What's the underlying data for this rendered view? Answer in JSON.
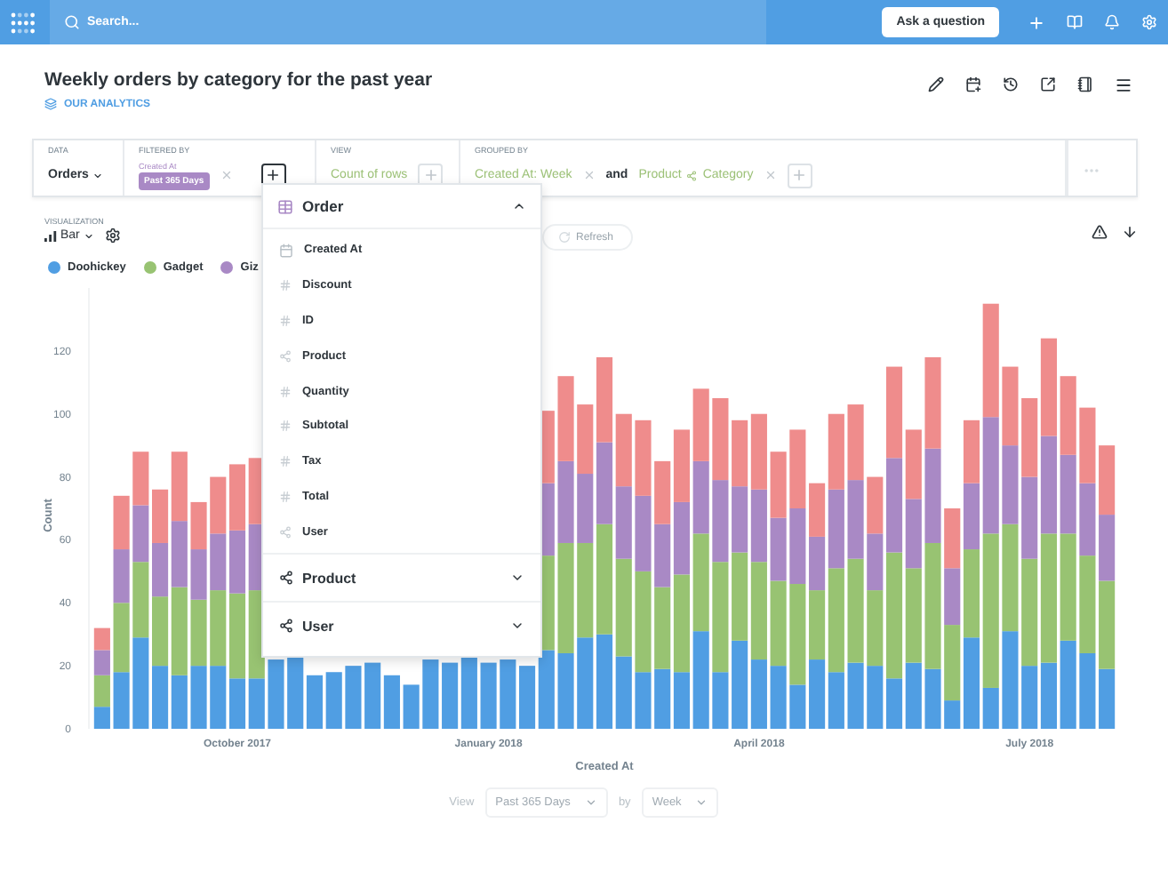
{
  "nav": {
    "search": {
      "placeholder": "Search..."
    },
    "ask_button": "Ask a question"
  },
  "question": {
    "title": "Weekly orders by category for the past year",
    "collection": "OUR ANALYTICS"
  },
  "builder": {
    "data": {
      "label": "DATA",
      "value": "Orders"
    },
    "filter": {
      "label": "FILTERED BY",
      "field": "Created At",
      "value": "Past 365 Days",
      "add_open": true
    },
    "view": {
      "label": "VIEW",
      "metric": "Count of rows"
    },
    "group": {
      "label": "GROUPED BY",
      "connector": "and",
      "items": [
        {
          "field": "Created At: Week"
        },
        {
          "table": "Product",
          "field": "Category"
        }
      ]
    }
  },
  "popover": {
    "table": "Order",
    "expanded": true,
    "fields": [
      {
        "name": "Created At",
        "kind": "date"
      },
      {
        "name": "Discount",
        "kind": "number"
      },
      {
        "name": "ID",
        "kind": "number"
      },
      {
        "name": "Product",
        "kind": "link"
      },
      {
        "name": "Quantity",
        "kind": "number"
      },
      {
        "name": "Subtotal",
        "kind": "number"
      },
      {
        "name": "Tax",
        "kind": "number"
      },
      {
        "name": "Total",
        "kind": "number"
      },
      {
        "name": "User",
        "kind": "link"
      }
    ],
    "sections": [
      {
        "name": "Product",
        "expanded": false
      },
      {
        "name": "User",
        "expanded": false
      }
    ]
  },
  "visualization": {
    "label": "VISUALIZATION",
    "type": "Bar",
    "refresh": "Refresh"
  },
  "chart_data": {
    "type": "bar",
    "stacked": true,
    "xlabel": "Created At",
    "ylabel": "Count",
    "ylim": [
      0,
      140
    ],
    "yticks": [
      {
        "value": 0,
        "label": "0"
      },
      {
        "value": 20,
        "label": "20"
      },
      {
        "value": 40,
        "label": "40"
      },
      {
        "value": 60,
        "label": "60"
      },
      {
        "value": 80,
        "label": "80"
      },
      {
        "value": 100,
        "label": "100"
      },
      {
        "value": 120,
        "label": "120"
      }
    ],
    "categories": [
      null,
      null,
      null,
      null,
      null,
      null,
      null,
      "October 2017",
      null,
      null,
      null,
      null,
      null,
      null,
      null,
      null,
      null,
      null,
      null,
      null,
      "January 2018",
      null,
      null,
      null,
      null,
      null,
      null,
      null,
      null,
      null,
      null,
      null,
      null,
      null,
      "April 2018",
      null,
      null,
      null,
      null,
      null,
      null,
      null,
      null,
      null,
      null,
      null,
      null,
      null,
      "July 2018",
      null,
      null,
      null,
      null
    ],
    "series": [
      {
        "name": "Doohickey",
        "color": "#509ee3",
        "values": [
          7,
          18,
          29,
          20,
          17,
          20,
          20,
          16,
          16,
          22,
          24,
          17,
          18,
          20,
          21,
          17,
          14,
          22,
          21,
          23,
          21,
          22,
          20,
          25,
          24,
          29,
          30,
          23,
          18,
          19,
          18,
          31,
          18,
          28,
          22,
          20,
          14,
          22,
          18,
          21,
          20,
          16,
          21,
          19,
          9,
          29,
          13,
          31,
          20,
          21,
          28,
          24,
          19
        ]
      },
      {
        "name": "Gadget",
        "color": "#98c372",
        "values": [
          10,
          22,
          24,
          22,
          28,
          21,
          24,
          27,
          28,
          null,
          null,
          null,
          null,
          null,
          null,
          null,
          null,
          null,
          null,
          null,
          null,
          null,
          null,
          30,
          35,
          30,
          35,
          31,
          32,
          26,
          31,
          31,
          35,
          28,
          31,
          27,
          32,
          22,
          33,
          33,
          24,
          40,
          30,
          40,
          24,
          28,
          49,
          34,
          34,
          41,
          34,
          31,
          28
        ]
      },
      {
        "name": "Giz",
        "color": "#a989c5",
        "values": [
          8,
          17,
          18,
          17,
          21,
          16,
          18,
          20,
          21,
          null,
          null,
          null,
          null,
          null,
          null,
          null,
          null,
          null,
          null,
          null,
          null,
          null,
          null,
          23,
          26,
          22,
          26,
          23,
          24,
          20,
          23,
          23,
          26,
          21,
          23,
          20,
          24,
          17,
          25,
          25,
          18,
          30,
          22,
          30,
          18,
          21,
          37,
          25,
          26,
          31,
          25,
          23,
          21
        ]
      },
      {
        "color": "#ef8c8c",
        "values": [
          7,
          17,
          17,
          17,
          22,
          15,
          18,
          21,
          21,
          null,
          null,
          null,
          null,
          null,
          null,
          null,
          null,
          null,
          null,
          null,
          null,
          null,
          null,
          23,
          27,
          22,
          27,
          23,
          24,
          20,
          23,
          23,
          26,
          21,
          24,
          21,
          25,
          17,
          24,
          24,
          18,
          29,
          22,
          29,
          19,
          20,
          36,
          25,
          25,
          31,
          25,
          24,
          22
        ]
      }
    ]
  },
  "footer": {
    "view_label": "View",
    "range": "Past 365 Days",
    "by_label": "by",
    "unit": "Week"
  }
}
